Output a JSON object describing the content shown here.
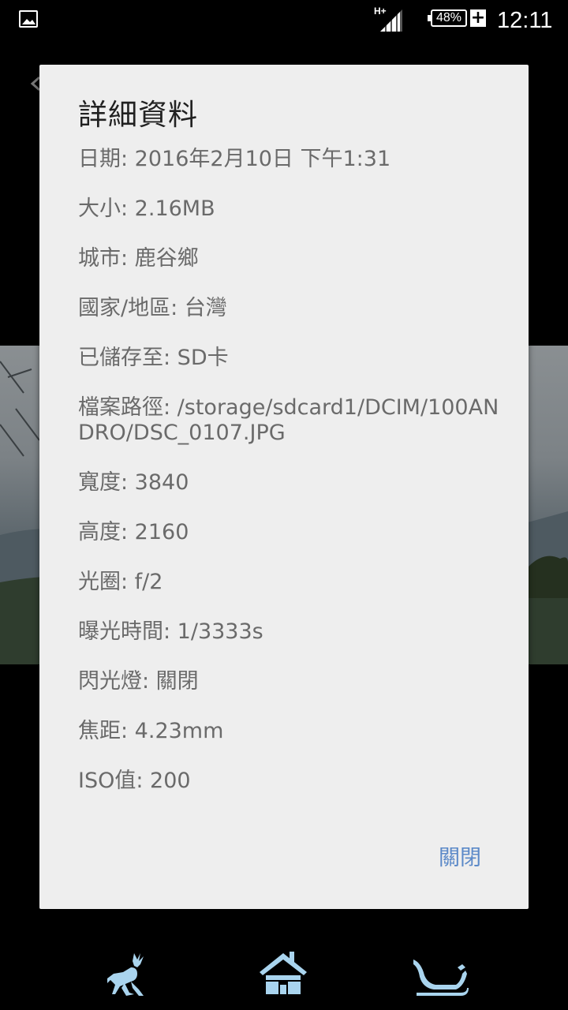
{
  "status_bar": {
    "network_type": "H+",
    "battery_percent": "48%",
    "battery_charging_symbol": "+",
    "time": "12:11",
    "icons": [
      "gallery-icon",
      "signal-icon",
      "battery-icon"
    ]
  },
  "dialog": {
    "title": "詳細資料",
    "details": [
      "日期: 2016年2月10日 下午1:31",
      "大小: 2.16MB",
      "城市: 鹿谷鄉",
      "國家/地區: 台灣",
      "已儲存至: SD卡",
      "檔案路徑: /storage/sdcard1/DCIM/100ANDRO/DSC_0107.JPG",
      "寬度: 3840",
      "高度: 2160",
      "光圈: f/2",
      "曝光時間: 1/3333s",
      "閃光燈: 關閉",
      "焦距: 4.23mm",
      "ISO值: 200"
    ],
    "close_label": "關閉",
    "accent_color": "#5b89c8"
  },
  "bottom_nav": {
    "icons": [
      "reindeer-icon",
      "house-icon",
      "sleigh-icon"
    ],
    "icon_color": "#a9d4ee"
  }
}
